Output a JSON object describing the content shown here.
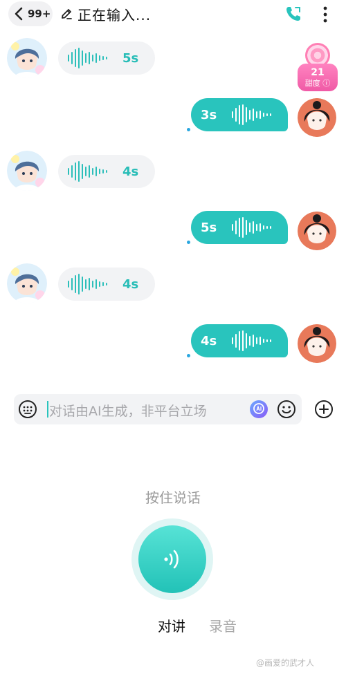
{
  "header": {
    "unread_count": "99+",
    "status_title": "正在输入..."
  },
  "badge": {
    "value": "21",
    "label": "甜度"
  },
  "messages": [
    {
      "side": "in",
      "duration": "5s"
    },
    {
      "side": "out",
      "duration": "3s"
    },
    {
      "side": "in",
      "duration": "4s"
    },
    {
      "side": "out",
      "duration": "5s"
    },
    {
      "side": "in",
      "duration": "4s"
    },
    {
      "side": "out",
      "duration": "4s"
    }
  ],
  "input": {
    "placeholder": "对话由AI生成，非平台立场"
  },
  "voice": {
    "hint": "按住说话",
    "modes": [
      "对讲",
      "录音"
    ],
    "active_mode": "对讲"
  },
  "watermark": "@画爱的武才人",
  "colors": {
    "accent": "#29c4bd",
    "badge": "#f05aa6",
    "bubble_in": "#f2f3f5"
  }
}
